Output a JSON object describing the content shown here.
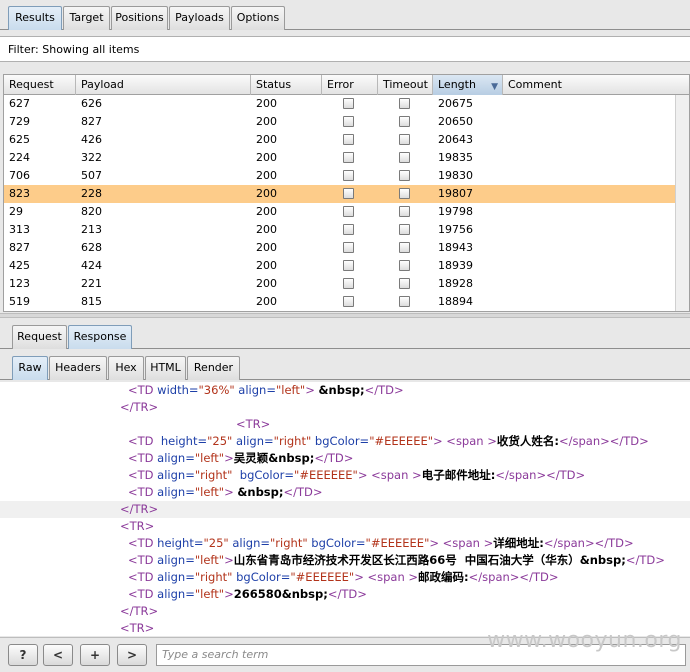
{
  "main_tabs": [
    "Results",
    "Target",
    "Positions",
    "Payloads",
    "Options"
  ],
  "filter_text": "Filter:  Showing all items",
  "columns": [
    "Request",
    "Payload",
    "Status",
    "Error",
    "Timeout",
    "Length",
    "Comment"
  ],
  "sort_column": "Length",
  "rows": [
    {
      "request": "627",
      "payload": "626",
      "status": "200",
      "length": "20675",
      "selected": false
    },
    {
      "request": "729",
      "payload": "827",
      "status": "200",
      "length": "20650",
      "selected": false
    },
    {
      "request": "625",
      "payload": "426",
      "status": "200",
      "length": "20643",
      "selected": false
    },
    {
      "request": "224",
      "payload": "322",
      "status": "200",
      "length": "19835",
      "selected": false
    },
    {
      "request": "706",
      "payload": "507",
      "status": "200",
      "length": "19830",
      "selected": false
    },
    {
      "request": "823",
      "payload": "228",
      "status": "200",
      "length": "19807",
      "selected": true
    },
    {
      "request": "29",
      "payload": "820",
      "status": "200",
      "length": "19798",
      "selected": false
    },
    {
      "request": "313",
      "payload": "213",
      "status": "200",
      "length": "19756",
      "selected": false
    },
    {
      "request": "827",
      "payload": "628",
      "status": "200",
      "length": "18943",
      "selected": false
    },
    {
      "request": "425",
      "payload": "424",
      "status": "200",
      "length": "18939",
      "selected": false
    },
    {
      "request": "123",
      "payload": "221",
      "status": "200",
      "length": "18928",
      "selected": false
    },
    {
      "request": "519",
      "payload": "815",
      "status": "200",
      "length": "18894",
      "selected": false
    }
  ],
  "rr_tabs": [
    "Request",
    "Response"
  ],
  "rr_active": "Response",
  "view_tabs": [
    "Raw",
    "Headers",
    "Hex",
    "HTML",
    "Render"
  ],
  "view_active": "Raw",
  "code_lines": [
    {
      "indent": 128,
      "hl": false,
      "tokens": [
        [
          "t",
          "<TD "
        ],
        [
          "a",
          "width="
        ],
        [
          "v",
          "\"36%\""
        ],
        [
          "a",
          " align="
        ],
        [
          "v",
          "\"left\""
        ],
        [
          "t",
          "> "
        ],
        [
          "b",
          "&nbsp;"
        ],
        [
          "t",
          "</TD>"
        ]
      ]
    },
    {
      "indent": 120,
      "hl": false,
      "tokens": [
        [
          "t",
          "</TR>"
        ]
      ]
    },
    {
      "indent": 236,
      "hl": false,
      "tokens": [
        [
          "t",
          "<TR>"
        ]
      ]
    },
    {
      "indent": 128,
      "hl": false,
      "tokens": [
        [
          "t",
          "<TD  "
        ],
        [
          "a",
          "height="
        ],
        [
          "v",
          "\"25\""
        ],
        [
          "a",
          " align="
        ],
        [
          "v",
          "\"right\""
        ],
        [
          "a",
          " bgColor="
        ],
        [
          "v",
          "\"#EEEEEE\""
        ],
        [
          "t",
          "> <span >"
        ],
        [
          "b",
          "收货人姓名:"
        ],
        [
          "t",
          "</span></TD>"
        ]
      ]
    },
    {
      "indent": 128,
      "hl": false,
      "tokens": [
        [
          "t",
          "<TD "
        ],
        [
          "a",
          "align="
        ],
        [
          "v",
          "\"left\""
        ],
        [
          "t",
          ">"
        ],
        [
          "b",
          "吴灵颖&nbsp;"
        ],
        [
          "t",
          "</TD>"
        ]
      ]
    },
    {
      "indent": 128,
      "hl": false,
      "tokens": [
        [
          "t",
          "<TD "
        ],
        [
          "a",
          "align="
        ],
        [
          "v",
          "\"right\""
        ],
        [
          "a",
          "  bgColor="
        ],
        [
          "v",
          "\"#EEEEEE\""
        ],
        [
          "t",
          "> <span >"
        ],
        [
          "b",
          "电子邮件地址:"
        ],
        [
          "t",
          "</span></TD>"
        ]
      ]
    },
    {
      "indent": 128,
      "hl": false,
      "tokens": [
        [
          "t",
          "<TD "
        ],
        [
          "a",
          "align="
        ],
        [
          "v",
          "\"left\""
        ],
        [
          "t",
          "> "
        ],
        [
          "b",
          "&nbsp;"
        ],
        [
          "t",
          "</TD>"
        ]
      ]
    },
    {
      "indent": 120,
      "hl": true,
      "tokens": [
        [
          "t",
          "</TR>"
        ]
      ]
    },
    {
      "indent": 120,
      "hl": false,
      "tokens": [
        [
          "t",
          "<TR>"
        ]
      ]
    },
    {
      "indent": 128,
      "hl": false,
      "tokens": [
        [
          "t",
          "<TD "
        ],
        [
          "a",
          "height="
        ],
        [
          "v",
          "\"25\""
        ],
        [
          "a",
          " align="
        ],
        [
          "v",
          "\"right\""
        ],
        [
          "a",
          " bgColor="
        ],
        [
          "v",
          "\"#EEEEEE\""
        ],
        [
          "t",
          "> <span >"
        ],
        [
          "b",
          "详细地址:"
        ],
        [
          "t",
          "</span></TD>"
        ]
      ]
    },
    {
      "indent": 128,
      "hl": false,
      "tokens": [
        [
          "t",
          "<TD "
        ],
        [
          "a",
          "align="
        ],
        [
          "v",
          "\"left\""
        ],
        [
          "t",
          ">"
        ],
        [
          "b",
          "山东省青岛市经济技术开发区长江西路66号  中国石油大学（华东）&nbsp;"
        ],
        [
          "t",
          "</TD>"
        ]
      ]
    },
    {
      "indent": 128,
      "hl": false,
      "tokens": [
        [
          "t",
          "<TD "
        ],
        [
          "a",
          "align="
        ],
        [
          "v",
          "\"right\""
        ],
        [
          "a",
          " bgColor="
        ],
        [
          "v",
          "\"#EEEEEE\""
        ],
        [
          "t",
          "> <span >"
        ],
        [
          "b",
          "邮政编码:"
        ],
        [
          "t",
          "</span></TD>"
        ]
      ]
    },
    {
      "indent": 128,
      "hl": false,
      "tokens": [
        [
          "t",
          "<TD "
        ],
        [
          "a",
          "align="
        ],
        [
          "v",
          "\"left\""
        ],
        [
          "t",
          ">"
        ],
        [
          "b",
          "266580&nbsp;"
        ],
        [
          "t",
          "</TD>"
        ]
      ]
    },
    {
      "indent": 120,
      "hl": false,
      "tokens": [
        [
          "t",
          "</TR>"
        ]
      ]
    },
    {
      "indent": 120,
      "hl": false,
      "tokens": [
        [
          "t",
          "<TR>"
        ]
      ]
    }
  ],
  "bottom_buttons": [
    "?",
    "<",
    "+",
    ">"
  ],
  "search_placeholder": "Type a search term",
  "watermark": "www.wooyun.org"
}
